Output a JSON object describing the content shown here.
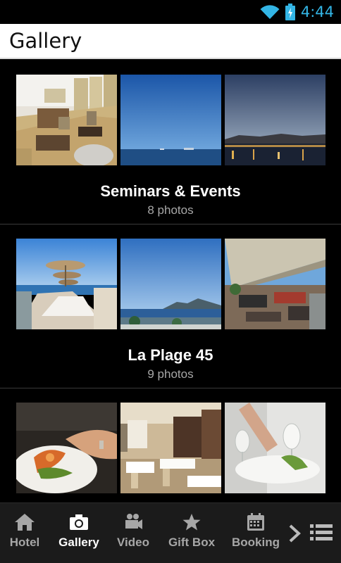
{
  "status_bar": {
    "time": "4:44",
    "icons": [
      "wifi-icon",
      "battery-icon"
    ],
    "accent_color": "#33b5e5"
  },
  "header": {
    "title": "Gallery"
  },
  "albums": [
    {
      "title": "Seminars & Events",
      "count": "8 photos",
      "thumbnails": [
        "conference-room-photo",
        "sea-horizon-photo",
        "night-harbor-photo"
      ]
    },
    {
      "title": "La Plage 45",
      "count": "9 photos",
      "thumbnails": [
        "beach-umbrellas-photo",
        "bay-mountains-photo",
        "terrace-lounge-photo"
      ]
    },
    {
      "title": "",
      "count": "",
      "thumbnails": [
        "chef-plating-photo",
        "restaurant-dining-photo",
        "wine-glasses-photo"
      ]
    }
  ],
  "bottom_nav": {
    "items": [
      {
        "label": "Hotel",
        "icon": "home-icon"
      },
      {
        "label": "Gallery",
        "icon": "camera-icon",
        "active": true
      },
      {
        "label": "Video",
        "icon": "video-camera-icon"
      },
      {
        "label": "Gift Box",
        "icon": "star-icon"
      },
      {
        "label": "Booking",
        "icon": "calendar-icon"
      }
    ],
    "more_icon": "chevron-right-icon",
    "menu_icon": "menu-icon"
  }
}
